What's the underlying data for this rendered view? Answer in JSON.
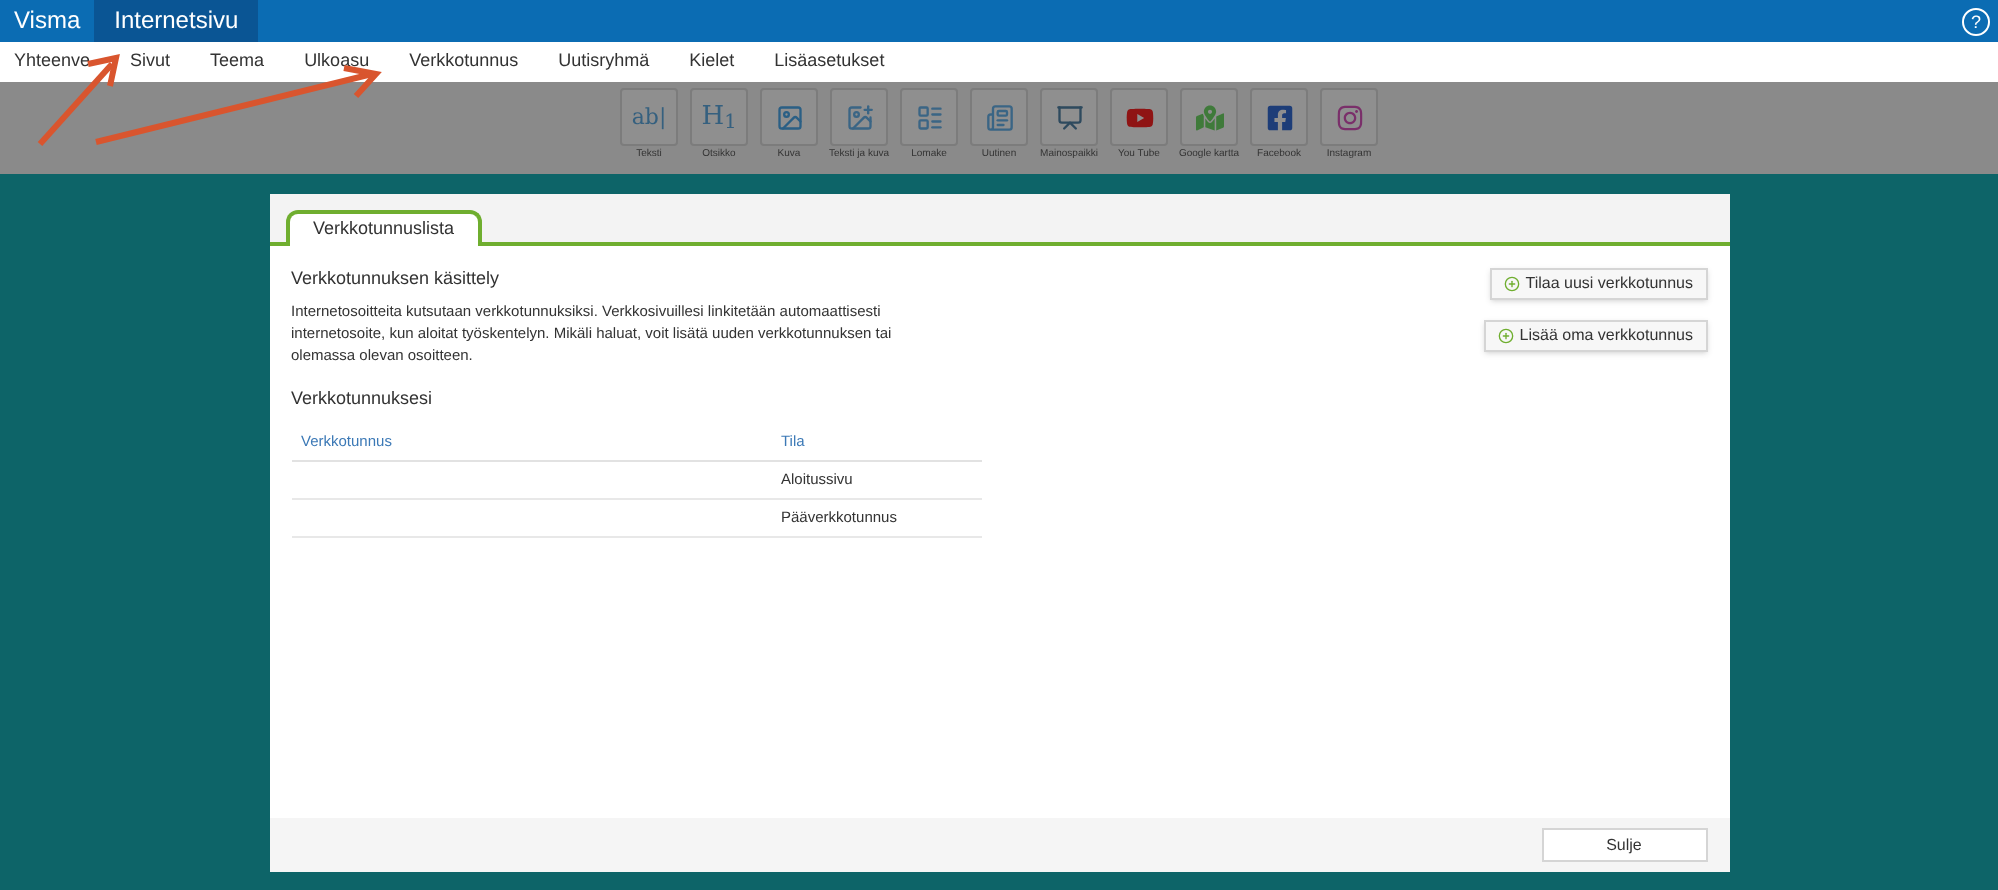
{
  "top_bar": {
    "brand": "Visma",
    "tabs": [
      {
        "label": "Internetsivu",
        "selected": true
      }
    ],
    "help": "?"
  },
  "menu": [
    {
      "label": "Yhteenve"
    },
    {
      "label": "Sivut"
    },
    {
      "label": "Teema"
    },
    {
      "label": "Ulkoasu"
    },
    {
      "label": "Verkkotunnus"
    },
    {
      "label": "Uutisryhmä"
    },
    {
      "label": "Kielet"
    },
    {
      "label": "Lisäasetukset"
    }
  ],
  "toolbar": [
    {
      "kind": "text",
      "label": "Teksti",
      "glyph": "ab|"
    },
    {
      "kind": "heading",
      "label": "Otsikko",
      "glyph": "H$_{1}$"
    },
    {
      "kind": "image",
      "label": "Kuva"
    },
    {
      "kind": "text-image",
      "label": "Teksti ja kuva"
    },
    {
      "kind": "form",
      "label": "Lomake"
    },
    {
      "kind": "news",
      "label": "Uutinen"
    },
    {
      "kind": "slideshow",
      "label": "Mainospaikki"
    },
    {
      "kind": "youtube",
      "label": "You Tube"
    },
    {
      "kind": "map",
      "label": "Google kartta"
    },
    {
      "kind": "facebook",
      "label": "Facebook"
    },
    {
      "kind": "instagram",
      "label": "Instagram"
    }
  ],
  "dialog": {
    "tabs": [
      {
        "label": "Verkkotunnuslista",
        "selected": true
      }
    ],
    "section_title": "Verkkotunnuksen käsittely",
    "description": "Internetosoitteita kutsutaan verkkotunnuksiksi. Verkkosivuillesi linkitetään automaattisesti internetosoite, kun aloitat työskentelyn. Mikäli haluat, voit lisätä uuden verkkotunnuksen tai olemassa olevan osoitteen.",
    "list_title": "Verkkotunnuksesi",
    "table": {
      "columns": [
        "Verkkotunnus",
        "Tila"
      ],
      "rows": [
        [
          "",
          "Aloitussivu"
        ],
        [
          "",
          "Pääverkkotunnus"
        ]
      ]
    },
    "actions": [
      {
        "label": "Tilaa uusi verkkotunnus"
      },
      {
        "label": "Lisää oma verkkotunnus"
      }
    ],
    "close": "Sulje"
  }
}
